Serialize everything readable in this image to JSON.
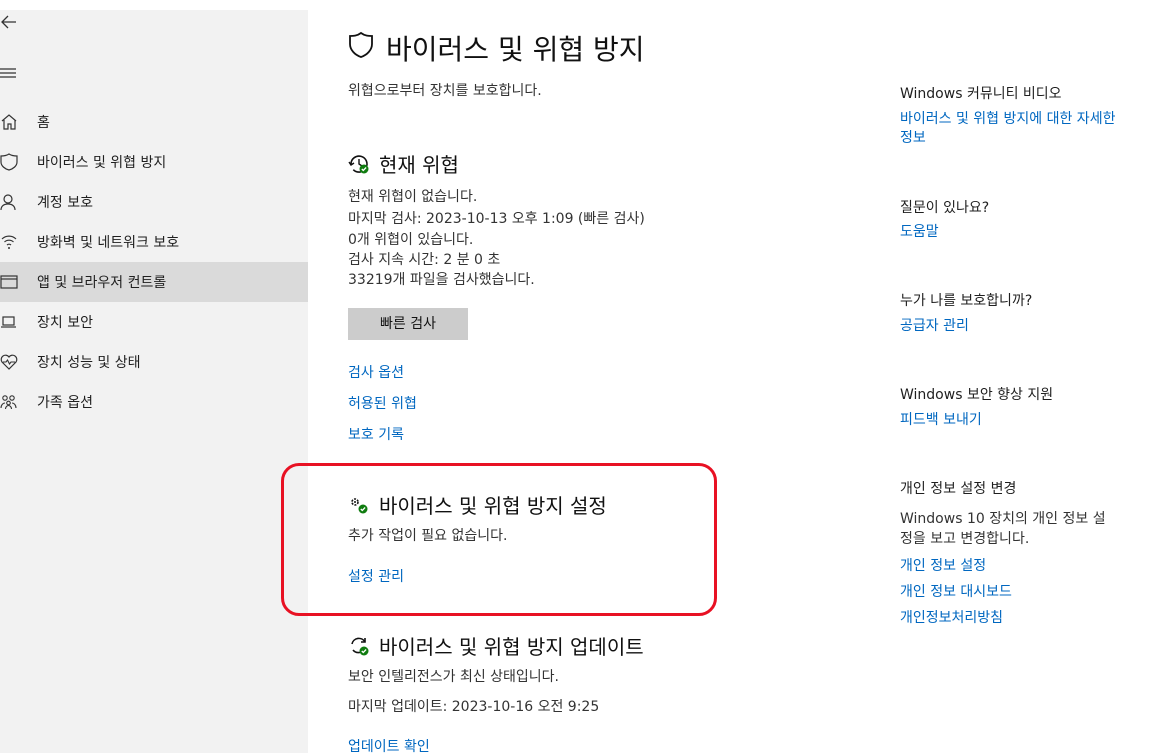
{
  "sidebar": {
    "items": [
      {
        "label": "홈",
        "icon": "home-icon"
      },
      {
        "label": "바이러스 및 위협 방지",
        "icon": "shield-icon"
      },
      {
        "label": "계정 보호",
        "icon": "person-icon"
      },
      {
        "label": "방화벽 및 네트워크 보호",
        "icon": "wifi-icon"
      },
      {
        "label": "앱 및 브라우저 컨트롤",
        "icon": "app-window-icon"
      },
      {
        "label": "장치 보안",
        "icon": "laptop-icon"
      },
      {
        "label": "장치 성능 및 상태",
        "icon": "heart-pulse-icon"
      },
      {
        "label": "가족 옵션",
        "icon": "family-icon"
      }
    ]
  },
  "main": {
    "title": "바이러스 및 위협 방지",
    "subtitle": "위협으로부터 장치를 보호합니다.",
    "current_threats": {
      "title": "현재 위협",
      "lines": [
        "현재 위협이 없습니다.",
        "마지막 검사: 2023-10-13 오후 1:09 (빠른 검사)",
        "0개 위협이 있습니다.",
        "검사 지속 시간: 2 분 0 초",
        "33219개 파일을 검사했습니다."
      ],
      "quick_scan_label": "빠른 검사",
      "links": [
        "검사 옵션",
        "허용된 위협",
        "보호 기록"
      ]
    },
    "settings": {
      "title": "바이러스 및 위협 방지 설정",
      "status": "추가 작업이 필요 없습니다.",
      "manage_link": "설정 관리"
    },
    "updates": {
      "title": "바이러스 및 위협 방지 업데이트",
      "status": "보안 인텔리전스가 최신 상태입니다.",
      "last_update": "마지막 업데이트: 2023-10-16 오전 9:25",
      "check_link": "업데이트 확인"
    }
  },
  "right": {
    "community": {
      "heading": "Windows 커뮤니티 비디오",
      "link_line1": "바이러스 및 위협 방지에 대한 자세한",
      "link_line2": "정보"
    },
    "question": {
      "heading": "질문이 있나요?",
      "link": "도움말"
    },
    "protector": {
      "heading": "누가 나를 보호합니까?",
      "link": "공급자 관리"
    },
    "improve": {
      "heading": "Windows 보안 향상 지원",
      "link": "피드백 보내기"
    },
    "privacy": {
      "heading": "개인 정보 설정 변경",
      "text_line1": "Windows 10 장치의 개인 정보 설",
      "text_line2": "정을 보고 변경합니다.",
      "links": [
        "개인 정보 설정",
        "개인 정보 대시보드",
        "개인정보처리방침"
      ]
    }
  },
  "colors": {
    "accent": "#0067c0",
    "highlight": "#e81123",
    "status_ok": "#107c10"
  }
}
